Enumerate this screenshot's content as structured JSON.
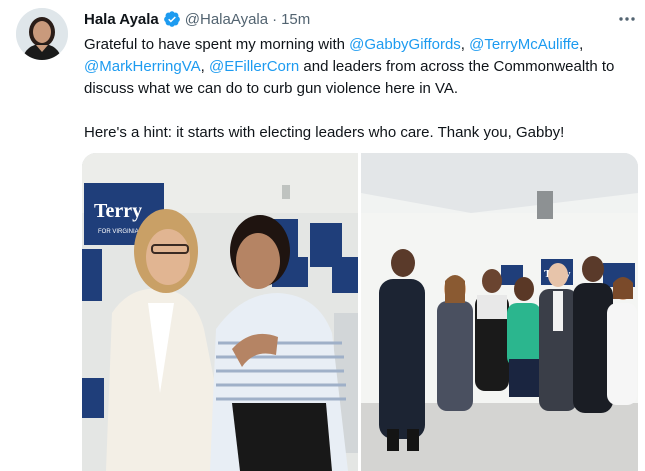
{
  "tweet": {
    "display_name": "Hala Ayala",
    "handle": "@HalaAyala",
    "separator": "·",
    "time": "15m",
    "text": {
      "intro": "Grateful to have spent my morning with ",
      "mention_1": "@GabbyGiffords",
      "comma_1": ", ",
      "mention_2": "@TerryMcAuliffe",
      "comma_2": ",",
      "mention_3": "@MarkHerringVA",
      "comma_3": ", ",
      "mention_4": "@EFillerCorn",
      "outro": " and leaders from across the Commonwealth to discuss what we can do to curb gun violence here in VA.",
      "paragraph_2": "Here's a hint: it starts with electing leaders who care. Thank you, Gabby!"
    }
  },
  "photos": {
    "left_sign_text": "Terry",
    "left_sign_subtext": "FOR VIRGINIA",
    "right_sign_text": "Terry"
  },
  "colors": {
    "link": "#1d9bf0",
    "verified": "#1d9bf0",
    "secondary_text": "#536471",
    "sign_blue": "#1f3e7a"
  },
  "icons": {
    "verified": "verified-badge-icon",
    "more": "more-horizontal-icon"
  }
}
